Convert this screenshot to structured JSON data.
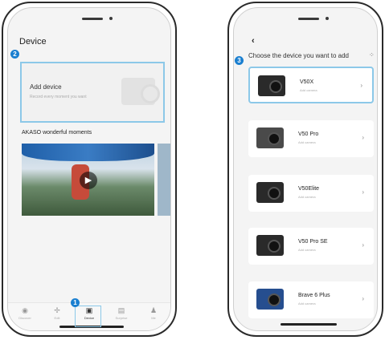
{
  "left": {
    "title": "Device",
    "add_device": {
      "title": "Add device",
      "subtitle": "Record every moment you want"
    },
    "moments_title": "AKASO wonderful moments",
    "tabs": [
      {
        "label": "Discover",
        "icon": "compass-icon"
      },
      {
        "label": "Edit",
        "icon": "edit-icon"
      },
      {
        "label": "Device",
        "icon": "device-icon"
      },
      {
        "label": "Surprise",
        "icon": "gift-icon"
      },
      {
        "label": "Me",
        "icon": "person-icon"
      }
    ],
    "badges": [
      "2",
      "1"
    ]
  },
  "right": {
    "back": "‹",
    "title": "Choose the device you want to add",
    "badge": "3",
    "devices": [
      {
        "name": "V50X",
        "subtitle": "Add camera"
      },
      {
        "name": "V50 Pro",
        "subtitle": "Add camera"
      },
      {
        "name": "V50Elite",
        "subtitle": "Add camera"
      },
      {
        "name": "V50 Pro SE",
        "subtitle": "Add camera"
      },
      {
        "name": "Brave 6 Plus",
        "subtitle": "Add camera"
      }
    ]
  },
  "colors": {
    "highlight": "#8cc8e8",
    "badge": "#1a7fd0"
  }
}
